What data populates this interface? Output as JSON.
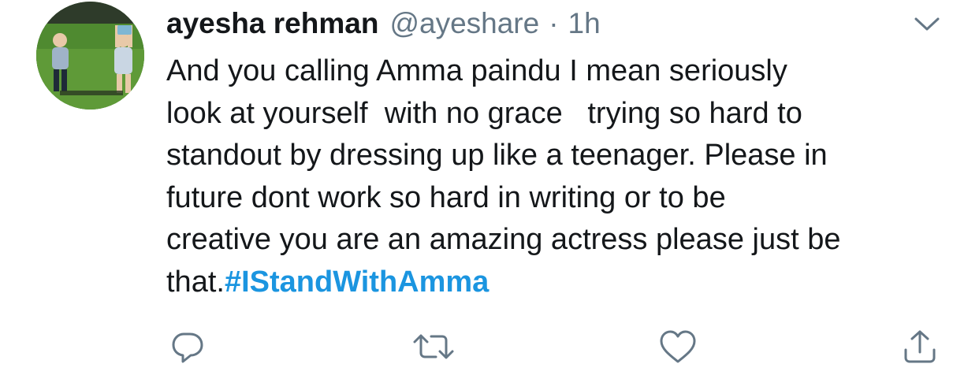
{
  "tweet": {
    "display_name": "ayesha rehman",
    "handle": "@ayeshare",
    "separator": "·",
    "time": "1h",
    "lines": [
      "And you calling Amma paindu I mean seriously",
      "look at yourself  with no grace   trying so hard to",
      "standout by dressing up like a teenager. Please in",
      "future dont work so hard in writing or to be",
      "creative you are an amazing actress please just be"
    ],
    "last_line_prefix": "that.",
    "hashtag": "#IStandWithAmma"
  },
  "icons": {
    "menu": "chevron-down-icon",
    "reply": "reply-icon",
    "retweet": "retweet-icon",
    "like": "heart-icon",
    "share": "share-icon"
  },
  "colors": {
    "text": "#14171a",
    "secondary": "#657786",
    "link": "#1b95e0",
    "icon": "#657786"
  }
}
